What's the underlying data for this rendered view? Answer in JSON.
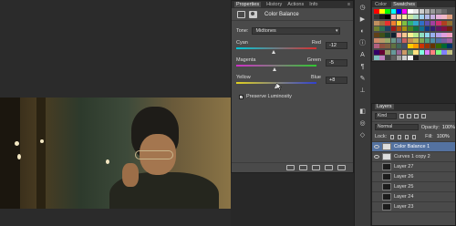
{
  "properties": {
    "tabs": [
      "Properties",
      "History",
      "Actions",
      "Info"
    ],
    "title": "Color Balance",
    "tone_label": "Tone:",
    "tone_value": "Midtones",
    "sliders": [
      {
        "left": "Cyan",
        "right": "Red",
        "value": "-12",
        "position": 0.47
      },
      {
        "left": "Magenta",
        "right": "Green",
        "value": "-5",
        "position": 0.48
      },
      {
        "left": "Yellow",
        "right": "Blue",
        "value": "+8",
        "position": 0.51
      }
    ],
    "preserve_luminosity": "Preserve Luminosity",
    "preserve_checked": true
  },
  "color_panel": {
    "tabs": [
      "Color",
      "Swatches"
    ]
  },
  "layers": {
    "tab": "Layers",
    "kind": "Kind",
    "blend": "Normal",
    "opacity_label": "Opacity:",
    "opacity_value": "100%",
    "lock_label": "Lock:",
    "fill_label": "Fill:",
    "fill_value": "100%",
    "items": [
      {
        "name": "Color Balance 1",
        "selected": true,
        "visible": true,
        "thumb": "adj"
      },
      {
        "name": "Curves 1 copy 2",
        "selected": false,
        "visible": true,
        "thumb": "adj"
      },
      {
        "name": "Layer 27",
        "selected": false,
        "visible": false,
        "thumb": "dark"
      },
      {
        "name": "Layer 26",
        "selected": false,
        "visible": false,
        "thumb": "dark"
      },
      {
        "name": "Layer 25",
        "selected": false,
        "visible": false,
        "thumb": "dark"
      },
      {
        "name": "Layer 24",
        "selected": false,
        "visible": false,
        "thumb": "dark"
      },
      {
        "name": "Layer 23",
        "selected": false,
        "visible": false,
        "thumb": "dark"
      }
    ]
  },
  "tools": [
    "history-icon",
    "play-icon",
    "adjust-icon",
    "info-icon",
    "type-icon",
    "paragraph-icon",
    "brush-icon",
    "stamp-icon",
    "layers-icon",
    "channels-icon",
    "paths-icon"
  ],
  "colors": {
    "selected_layer": "#5472a0"
  }
}
